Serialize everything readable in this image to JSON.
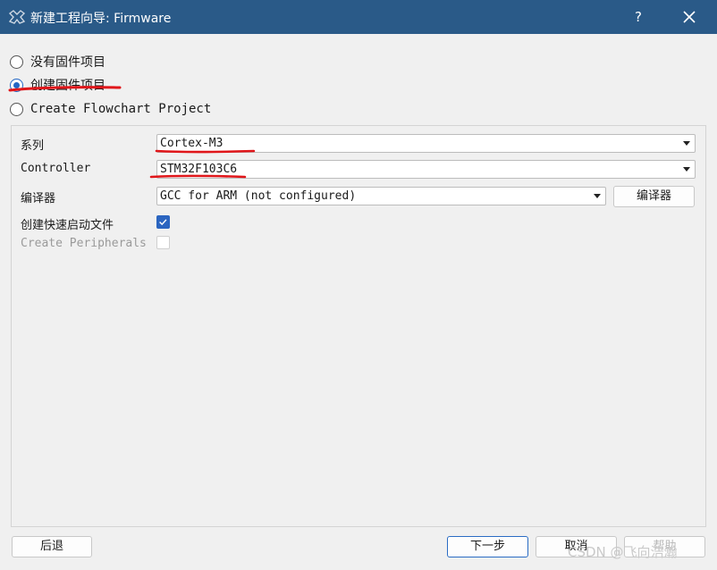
{
  "window": {
    "title": "新建工程向导: Firmware",
    "help_label": "?",
    "icon": "app-logo-icon",
    "close_icon": "close-icon"
  },
  "project_type": {
    "options": [
      {
        "label": "没有固件项目",
        "selected": false
      },
      {
        "label": "创建固件项目",
        "selected": true
      },
      {
        "label": "Create Flowchart Project",
        "selected": false
      }
    ]
  },
  "form": {
    "series_label": "系列",
    "series_value": "Cortex-M3",
    "controller_label": "Controller",
    "controller_value": "STM32F103C6",
    "compiler_label": "编译器",
    "compiler_value": "GCC for ARM (not configured)",
    "compiler_button": "编译器",
    "quickstart_label": "创建快速启动文件",
    "quickstart_checked": true,
    "peripherals_label": "Create Peripherals",
    "peripherals_checked": false
  },
  "footer": {
    "back_label": "后退",
    "next_label": "下一步",
    "cancel_label": "取消",
    "help_label": "帮助"
  },
  "watermark": "CSDN @飞向浩瀚",
  "colors": {
    "titlebar": "#2a5a88",
    "accent": "#2266c4",
    "annotation": "#e0161a"
  }
}
